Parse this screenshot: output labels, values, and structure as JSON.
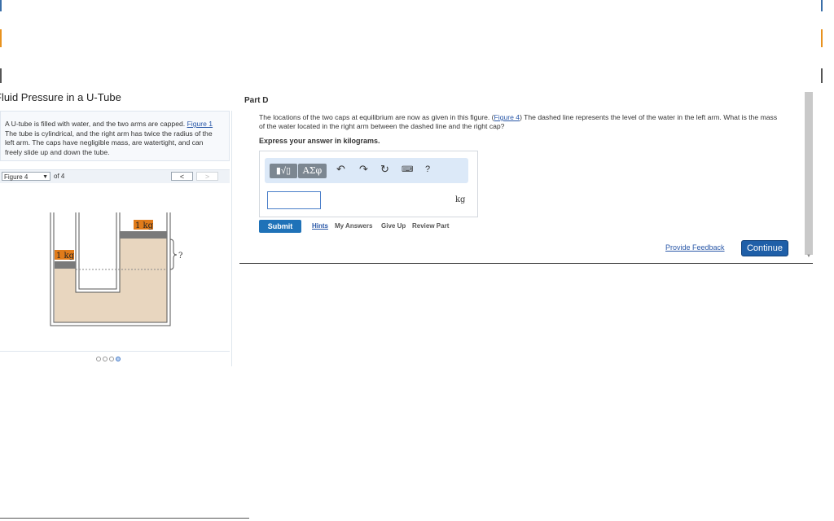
{
  "title": "Fluid Pressure in a U-Tube",
  "intro": {
    "text_before": "A U-tube is filled with water, and the two arms are capped.",
    "link": "Figure 1",
    "text_after": "The tube is cylindrical, and the right arm has twice the radius of the left arm. The caps have negligible mass, are watertight, and can freely slide up and down the tube."
  },
  "figure_nav": {
    "selected": "Figure 4",
    "of_label": "of 4",
    "prev": "<",
    "next": ">"
  },
  "figure": {
    "left_cap_label": "1 kg",
    "right_cap_label": "1 kg",
    "unknown_label": "?",
    "water_color": "#e8d6bf",
    "cap_color": "#7a7a7a",
    "label_color": "#e07b1a"
  },
  "pagination": {
    "count": 4,
    "active_index": 3
  },
  "part": {
    "title": "Part D",
    "question_before": "The locations of the two caps at equilibrium are now as given in this figure. (",
    "question_link": "Figure 4",
    "question_after": ") The dashed line represents the level of the water in the left arm. What is the mass of the water located in the right arm between the dashed line and the right cap?",
    "express": "Express your answer in kilograms."
  },
  "toolbar": {
    "templates_icon": "templates-icon",
    "greek_label": "ΑΣφ",
    "undo_icon": "undo-icon",
    "redo_icon": "redo-icon",
    "reset_icon": "reset-icon",
    "keyboard_icon": "keyboard-icon",
    "help_label": "?"
  },
  "answer": {
    "value": "",
    "unit": "kg"
  },
  "actions": {
    "submit": "Submit",
    "hints": "Hints",
    "my_answers": "My Answers",
    "give_up": "Give Up",
    "review_part": "Review Part"
  },
  "footer": {
    "feedback": "Provide Feedback",
    "continue": "Continue"
  },
  "colors": {
    "accent_blue": "#1f72b8",
    "link_blue": "#2a58a8",
    "edge_blue": "#3a6ea8",
    "edge_orange": "#e8921e"
  }
}
